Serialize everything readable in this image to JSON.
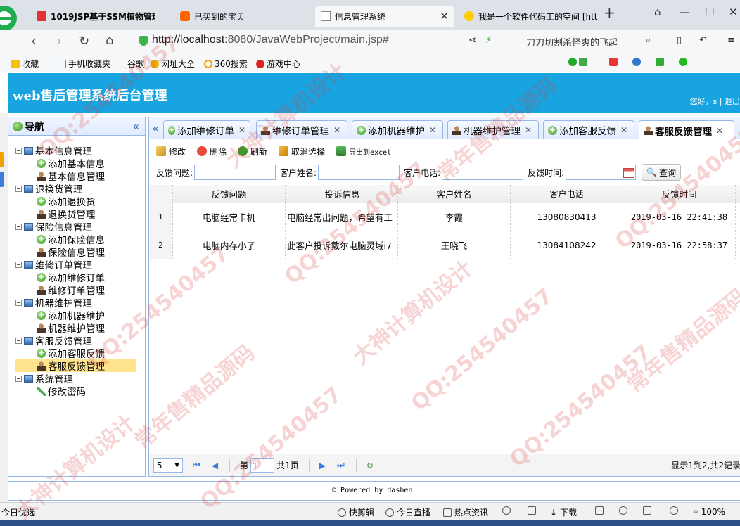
{
  "browser": {
    "tabs": [
      {
        "label": "1019JSP基于SSM植物管理",
        "active": false
      },
      {
        "label": "已买到的宝贝",
        "active": false
      },
      {
        "label": "信息管理系统",
        "active": true
      },
      {
        "label": "我是一个软件代码工的空间 [htt",
        "active": false
      }
    ],
    "url_host": "http://localhost",
    "url_path": ":8080/JavaWebProject/main.jsp#",
    "search_hint": "刀刀切割杀怪爽的飞起",
    "bookmarks": [
      "收藏",
      "手机收藏夹",
      "谷歌",
      "网址大全",
      "360搜索",
      "游戏中心"
    ]
  },
  "app": {
    "title": "web售后管理系统后台管理",
    "user_greeting": "您好，s",
    "logout": "退出"
  },
  "sidebar": {
    "title": "导航",
    "groups": [
      {
        "label": "基本信息管理",
        "children": [
          "添加基本信息",
          "基本信息管理"
        ]
      },
      {
        "label": "退换货管理",
        "children": [
          "添加退换货",
          "退换货管理"
        ]
      },
      {
        "label": "保险信息管理",
        "children": [
          "添加保险信息",
          "保险信息管理"
        ]
      },
      {
        "label": "维修订单管理",
        "children": [
          "添加维修订单",
          "维修订单管理"
        ]
      },
      {
        "label": "机器维护管理",
        "children": [
          "添加机器维护",
          "机器维护管理"
        ]
      },
      {
        "label": "客服反馈管理",
        "children": [
          "添加客服反馈",
          "客服反馈管理"
        ]
      },
      {
        "label": "系统管理",
        "children": [
          "修改密码"
        ]
      }
    ]
  },
  "tabs": [
    "添加维修订单",
    "维修订单管理",
    "添加机器维护",
    "机器维护管理",
    "添加客服反馈",
    "客服反馈管理"
  ],
  "toolbar": {
    "edit": "修改",
    "delete": "删除",
    "refresh": "刷新",
    "cancel_select": "取消选择",
    "export": "导出到excel"
  },
  "search": {
    "feedback_label": "反馈问题:",
    "name_label": "客户姓名:",
    "phone_label": "客户电话:",
    "time_label": "反馈时间:",
    "query_button": "查询"
  },
  "grid": {
    "columns": [
      "反馈问题",
      "投诉信息",
      "客户姓名",
      "客户电话",
      "反馈时间"
    ],
    "rows": [
      {
        "num": "1",
        "issue": "电脑经常卡机",
        "complaint": "电脑经常出问题，希望有工",
        "name": "李霞",
        "phone": "13080830413",
        "time": "2019-03-16 22:41:38"
      },
      {
        "num": "2",
        "issue": "电脑内存小了",
        "complaint": "此客户投诉戴尔电脑灵域i7",
        "name": "王晓飞",
        "phone": "13084108242",
        "time": "2019-03-16 22:58:37"
      }
    ]
  },
  "pager": {
    "page_size": "5",
    "page_prefix": "第",
    "page_value": "1",
    "page_suffix": "共1页",
    "info": "显示1到2,共2记录"
  },
  "footer": "Powered by dashen",
  "statusbar": {
    "left": "今日优选",
    "items": [
      "快剪辑",
      "今日直播",
      "热点资讯",
      "下载",
      "100%"
    ]
  },
  "watermarks": [
    "QQ:254540457",
    "大神计算机设计",
    "常年售精品源码"
  ],
  "colors": {
    "header_bg": "#18a4e0",
    "panel_border": "#95b8e7",
    "selected_bg": "#ffe48d"
  }
}
